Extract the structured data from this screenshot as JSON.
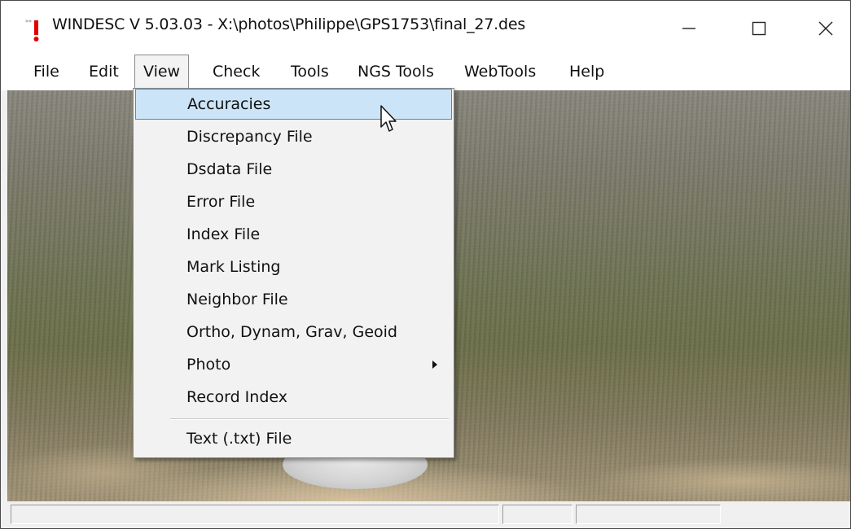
{
  "window": {
    "title": "WINDESC V 5.03.03 - X:\\photos\\Philippe\\GPS1753\\final_27.des",
    "app_icon": "windesc-app-icon",
    "controls": {
      "minimize_icon": "minimize-icon",
      "maximize_icon": "maximize-icon",
      "close_icon": "close-icon"
    }
  },
  "menubar": {
    "items": [
      {
        "label": "File"
      },
      {
        "label": "Edit"
      },
      {
        "label": "View",
        "open": true
      },
      {
        "label": "Check"
      },
      {
        "label": "Tools"
      },
      {
        "label": "NGS Tools"
      },
      {
        "label": "WebTools"
      },
      {
        "label": "Help"
      }
    ]
  },
  "view_menu": {
    "items": [
      {
        "label": "Accuracies",
        "highlighted": true
      },
      {
        "label": "Discrepancy File"
      },
      {
        "label": "Dsdata File"
      },
      {
        "label": "Error File"
      },
      {
        "label": "Index File"
      },
      {
        "label": "Mark Listing"
      },
      {
        "label": "Neighbor File"
      },
      {
        "label": "Ortho, Dynam, Grav, Geoid"
      },
      {
        "label": "Photo",
        "submenu": true,
        "submenu_icon": "submenu-arrow-icon"
      },
      {
        "label": "Record Index"
      },
      {
        "label": "Text (.txt) File"
      }
    ]
  },
  "content": {
    "image": "photo of grassy field with survey mark"
  },
  "colors": {
    "highlight_fill": "#cce4f7",
    "highlight_border": "#3c8ed8",
    "menu_bg": "#f2f2f2"
  }
}
